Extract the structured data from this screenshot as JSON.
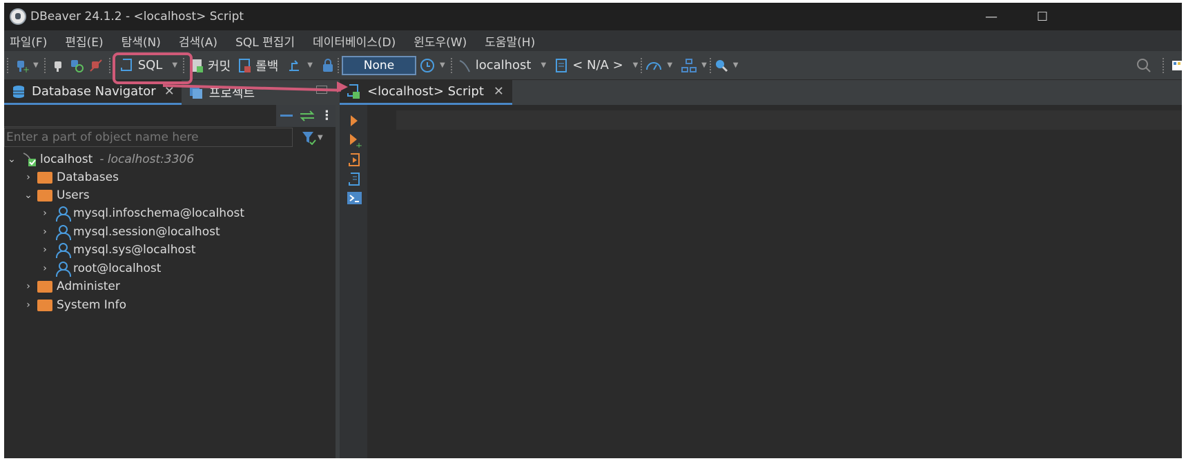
{
  "window": {
    "title": "DBeaver 24.1.2 - <localhost> Script",
    "minimize": "—",
    "maximize": "☐"
  },
  "menu": [
    "파일(F)",
    "편집(E)",
    "탐색(N)",
    "검색(A)",
    "SQL 편집기",
    "데이터베이스(D)",
    "윈도우(W)",
    "도움말(H)"
  ],
  "toolbar": {
    "sql_label": "SQL",
    "commit_label": "커밋",
    "rollback_label": "롤백",
    "transaction_mode": "None",
    "datasource_label": "localhost",
    "schema_label": "< N/A >"
  },
  "left_panel": {
    "tabs": [
      {
        "label": "Database Navigator",
        "close": "✕"
      },
      {
        "label": "프로젝트"
      }
    ],
    "filter_placeholder": "Enter a part of object name here",
    "tree": {
      "root": {
        "label": "localhost",
        "sub": "- localhost:3306"
      },
      "databases": "Databases",
      "users": "Users",
      "user_items": [
        "mysql.infoschema@localhost",
        "mysql.session@localhost",
        "mysql.sys@localhost",
        "root@localhost"
      ],
      "administer": "Administer",
      "system_info": "System Info"
    }
  },
  "editor": {
    "tab_label": "<localhost> Script",
    "tab_close": "✕"
  },
  "colors": {
    "highlight": "#d05a78",
    "accent": "#4a88c7",
    "folder": "#e8883a",
    "run": "#e8883a"
  }
}
